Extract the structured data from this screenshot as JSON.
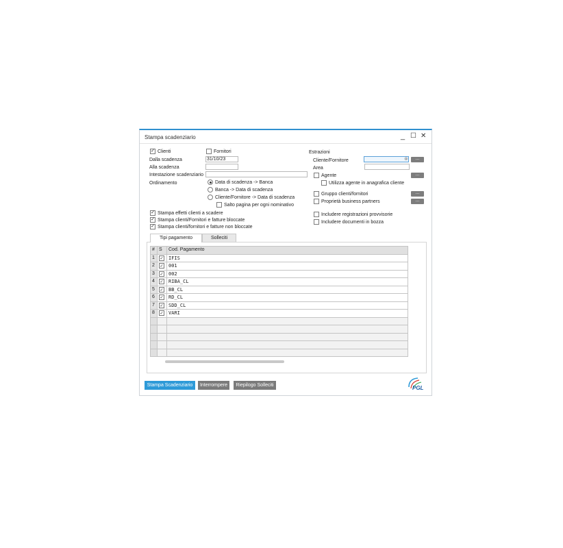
{
  "window": {
    "title": "Stampa scadenziario",
    "minimize_glyph": "_",
    "maximize_glyph": "☐",
    "close_glyph": "✕"
  },
  "left": {
    "clienti_label": "Clienti",
    "clienti_checked": true,
    "fornitori_label": "Fornitori",
    "fornitori_checked": false,
    "dalla_scadenza_label": "Dalla scadenza",
    "dalla_scadenza_value": "31/10/23",
    "alla_scadenza_label": "Alla scadenza",
    "alla_scadenza_value": "",
    "intestazione_label": "Intestazione scadenziario",
    "intestazione_value": "",
    "ordinamento_label": "Ordinamento",
    "ord_options": [
      "Data di scadenza -> Banca",
      "Banca -> Data di scadenza",
      "Cliente/Fornitore -> Data di scadenza"
    ],
    "ord_selected_index": 0,
    "salto_pagina_label": "Salto pagina per ogni nominativo",
    "salto_pagina_checked": false,
    "stampa_effetti_label": "Stampa effetti clienti a scadere",
    "stampa_bloccate_label": "Stampa clienti/Fornitori e fatture bloccate",
    "stampa_non_bloccate_label": "Stampa clienti/fornitori e fatture non bloccate"
  },
  "right": {
    "estrazioni_label": "Estrazioni",
    "cliente_fornitore_label": "Cliente/Fornitore",
    "cliente_fornitore_value": "",
    "area_label": "Area",
    "area_value": "",
    "agente_label": "Agente",
    "utilizza_agente_label": "Utilizza agente in anagrafica cliente",
    "gruppo_label": "Gruppo clienti/fornitori",
    "proprieta_label": "Proprietà business partners",
    "registrazioni_label": "Includere registrazioni provvisorie",
    "bozza_label": "Includere documenti in bozza",
    "browse_glyph": "..."
  },
  "tabs": [
    "Tipi pagamento",
    "Solleciti"
  ],
  "grid": {
    "headers": [
      "#",
      "S",
      "Cod. Pagamento"
    ],
    "rows": [
      {
        "n": "1",
        "code": "IFIS"
      },
      {
        "n": "2",
        "code": "001"
      },
      {
        "n": "3",
        "code": "002"
      },
      {
        "n": "4",
        "code": "RIBA_CL"
      },
      {
        "n": "5",
        "code": "BB_CL"
      },
      {
        "n": "6",
        "code": "RD_CL"
      },
      {
        "n": "7",
        "code": "SDD_CL"
      },
      {
        "n": "8",
        "code": "VARI"
      }
    ],
    "check_glyph": "✓"
  },
  "buttons": {
    "stampa": "Stampa Scadenziario",
    "interrompere": "Interrompere",
    "riepilogo": "Riepilogo Solleciti"
  },
  "colors": {
    "primary_button": "#2e9ad8",
    "secondary_button": "#7b7b7b",
    "title_accent": "#2f8fcf"
  },
  "logo_text": "PGL"
}
